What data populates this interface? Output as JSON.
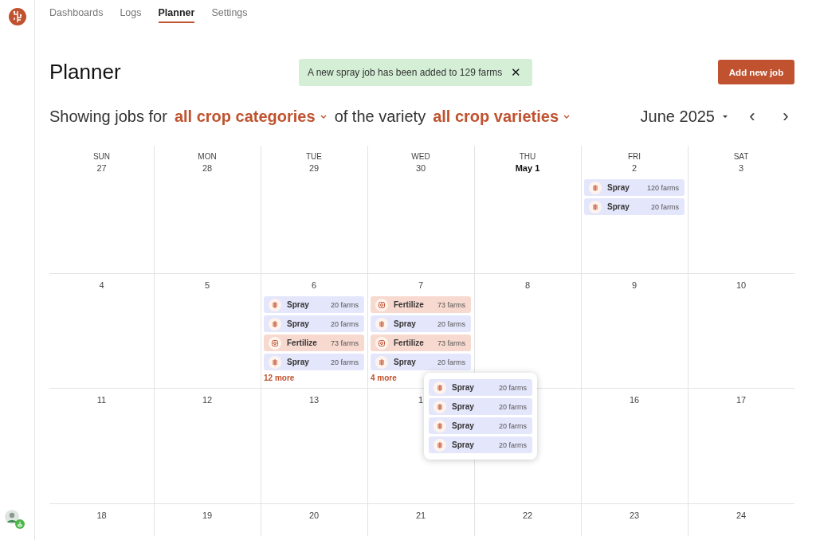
{
  "nav": {
    "tabs": [
      {
        "label": "Dashboards",
        "selected": false
      },
      {
        "label": "Logs",
        "selected": false
      },
      {
        "label": "Planner",
        "selected": true
      },
      {
        "label": "Settings",
        "selected": false
      }
    ]
  },
  "header": {
    "title": "Planner",
    "toast": {
      "message": "A new spray job has been added to 129 farms",
      "close": "✕"
    },
    "add_button": "Add new job"
  },
  "filter": {
    "prefix": "Showing jobs for",
    "category": "all crop categories",
    "middle": "of the variety",
    "variety": "all crop varieties",
    "month": "June 2025",
    "prev": "‹",
    "next": "›"
  },
  "calendar": {
    "weekdays": [
      "SUN",
      "MON",
      "TUE",
      "WED",
      "THU",
      "FRI",
      "SAT"
    ],
    "weeks": [
      [
        {
          "date": "27",
          "bold": false
        },
        {
          "date": "28",
          "bold": false
        },
        {
          "date": "29",
          "bold": false
        },
        {
          "date": "30",
          "bold": false
        },
        {
          "date": "May 1",
          "bold": true
        },
        {
          "date": "2",
          "bold": false,
          "jobs": [
            {
              "kind": "spray",
              "title": "Spray",
              "count": "120 farms"
            },
            {
              "kind": "spray",
              "title": "Spray",
              "count": "20 farms"
            }
          ]
        },
        {
          "date": "3",
          "bold": false
        }
      ],
      [
        {
          "date": "4",
          "bold": false
        },
        {
          "date": "5",
          "bold": false
        },
        {
          "date": "6",
          "bold": false,
          "jobs": [
            {
              "kind": "spray",
              "title": "Spray",
              "count": "20 farms"
            },
            {
              "kind": "spray",
              "title": "Spray",
              "count": "20 farms"
            },
            {
              "kind": "fertilize",
              "title": "Fertilize",
              "count": "73 farms"
            },
            {
              "kind": "spray",
              "title": "Spray",
              "count": "20 farms"
            }
          ],
          "more": "12 more"
        },
        {
          "date": "7",
          "bold": false,
          "jobs": [
            {
              "kind": "fertilize",
              "title": "Fertilize",
              "count": "73 farms"
            },
            {
              "kind": "spray",
              "title": "Spray",
              "count": "20 farms"
            },
            {
              "kind": "fertilize",
              "title": "Fertilize",
              "count": "73 farms"
            },
            {
              "kind": "spray",
              "title": "Spray",
              "count": "20 farms"
            }
          ],
          "more": "4 more"
        },
        {
          "date": "8",
          "bold": false
        },
        {
          "date": "9",
          "bold": false
        },
        {
          "date": "10",
          "bold": false
        }
      ],
      [
        {
          "date": "11",
          "bold": false
        },
        {
          "date": "12",
          "bold": false
        },
        {
          "date": "13",
          "bold": false
        },
        {
          "date": "1",
          "bold": false
        },
        {
          "popover": {
            "jobs": [
              {
                "kind": "spray",
                "title": "Spray",
                "count": "20 farms"
              },
              {
                "kind": "spray",
                "title": "Spray",
                "count": "20 farms"
              },
              {
                "kind": "spray",
                "title": "Spray",
                "count": "20 farms"
              },
              {
                "kind": "spray",
                "title": "Spray",
                "count": "20 farms"
              }
            ]
          }
        },
        {
          "date": "16",
          "bold": false
        },
        {
          "date": "17",
          "bold": false
        }
      ],
      [
        {
          "date": "18",
          "bold": false
        },
        {
          "date": "19",
          "bold": false
        },
        {
          "date": "20",
          "bold": false
        },
        {
          "date": "21",
          "bold": false
        },
        {
          "date": "22",
          "bold": false
        },
        {
          "date": "23",
          "bold": false
        },
        {
          "date": "24",
          "bold": false
        }
      ]
    ]
  }
}
